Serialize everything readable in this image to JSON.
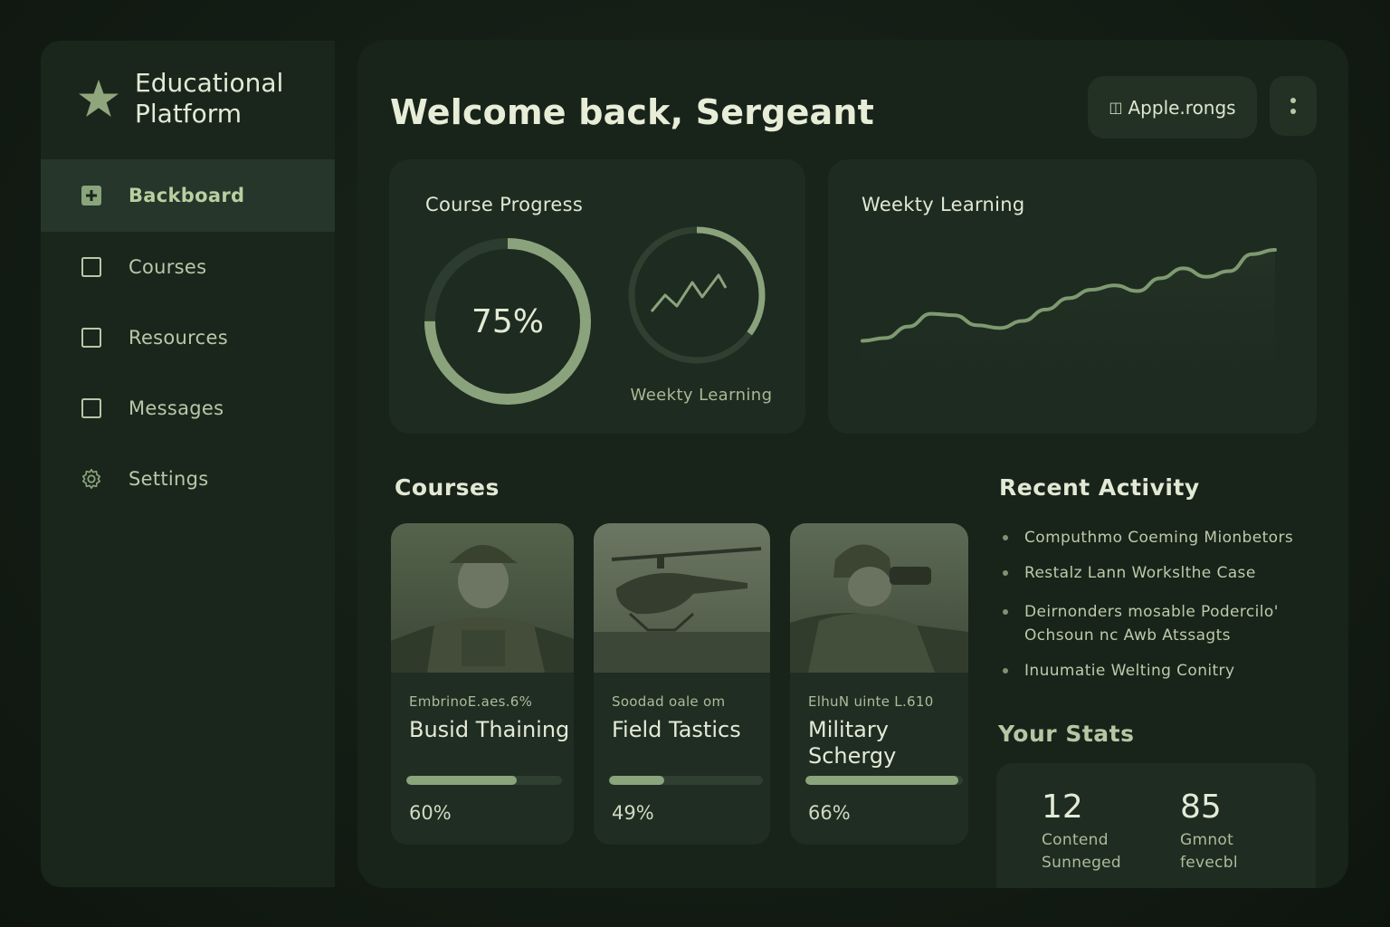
{
  "app": {
    "name": "Educational Platform",
    "logo_icon": "star-icon"
  },
  "sidebar": {
    "items": [
      {
        "label": "Backboard",
        "icon": "plus-square-icon",
        "active": true
      },
      {
        "label": "Courses",
        "icon": "square-icon",
        "active": false
      },
      {
        "label": "Resources",
        "icon": "square-icon",
        "active": false
      },
      {
        "label": "Messages",
        "icon": "square-icon",
        "active": false
      },
      {
        "label": "Settings",
        "icon": "gear-icon",
        "active": false
      }
    ]
  },
  "header": {
    "welcome": "Welcome back, Sergeant",
    "account_label": "Apple.rongs",
    "account_icon": "book-icon",
    "menu_icon": "kebab-icon"
  },
  "course_progress": {
    "title": "Course Progress",
    "percent_label": "75%",
    "percent": 75,
    "secondary_label": "Weekty Learning",
    "secondary_ring_fraction": 0.35
  },
  "weekly_learning": {
    "title": "Weekty Learning",
    "trend": [
      22,
      24,
      32,
      41,
      40,
      33,
      31,
      36,
      44,
      52,
      58,
      61,
      57,
      66,
      73,
      67,
      71,
      83,
      86
    ]
  },
  "courses": {
    "title": "Courses",
    "items": [
      {
        "subtitle": "EmbrinoE.aes.6%",
        "name": "Busid Thaining",
        "percent_label": "60%",
        "progress": 0.71,
        "image": "soldier-portrait-image"
      },
      {
        "subtitle": "Soodad oale om",
        "name": "Field Tastics",
        "percent_label": "49%",
        "progress": 0.36,
        "image": "helicopter-image"
      },
      {
        "subtitle": "ElhuN uinte L.610",
        "name": "Military Schergy",
        "percent_label": "66%",
        "progress": 0.97,
        "image": "soldier-binoculars-image"
      }
    ]
  },
  "recent_activity": {
    "title": "Recent Activity",
    "items": [
      "Computhmo Coeming Mionbetors",
      "Restalz Lann Workslthe Case",
      "Deirnonders mosable Podercilo' Ochsoun nc Awb Atssagts",
      "Inuumatie Welting Conitry"
    ]
  },
  "stats": {
    "title": "Your Stats",
    "items": [
      {
        "value": "12",
        "label": "Contend Sunneged"
      },
      {
        "value": "85",
        "label": "Gmnot fevecbl"
      }
    ]
  },
  "colors": {
    "background": "#111a12",
    "panel": "#18231a",
    "card": "#1e2b20",
    "accent": "#8aa47b",
    "text": "#e3ead6"
  }
}
